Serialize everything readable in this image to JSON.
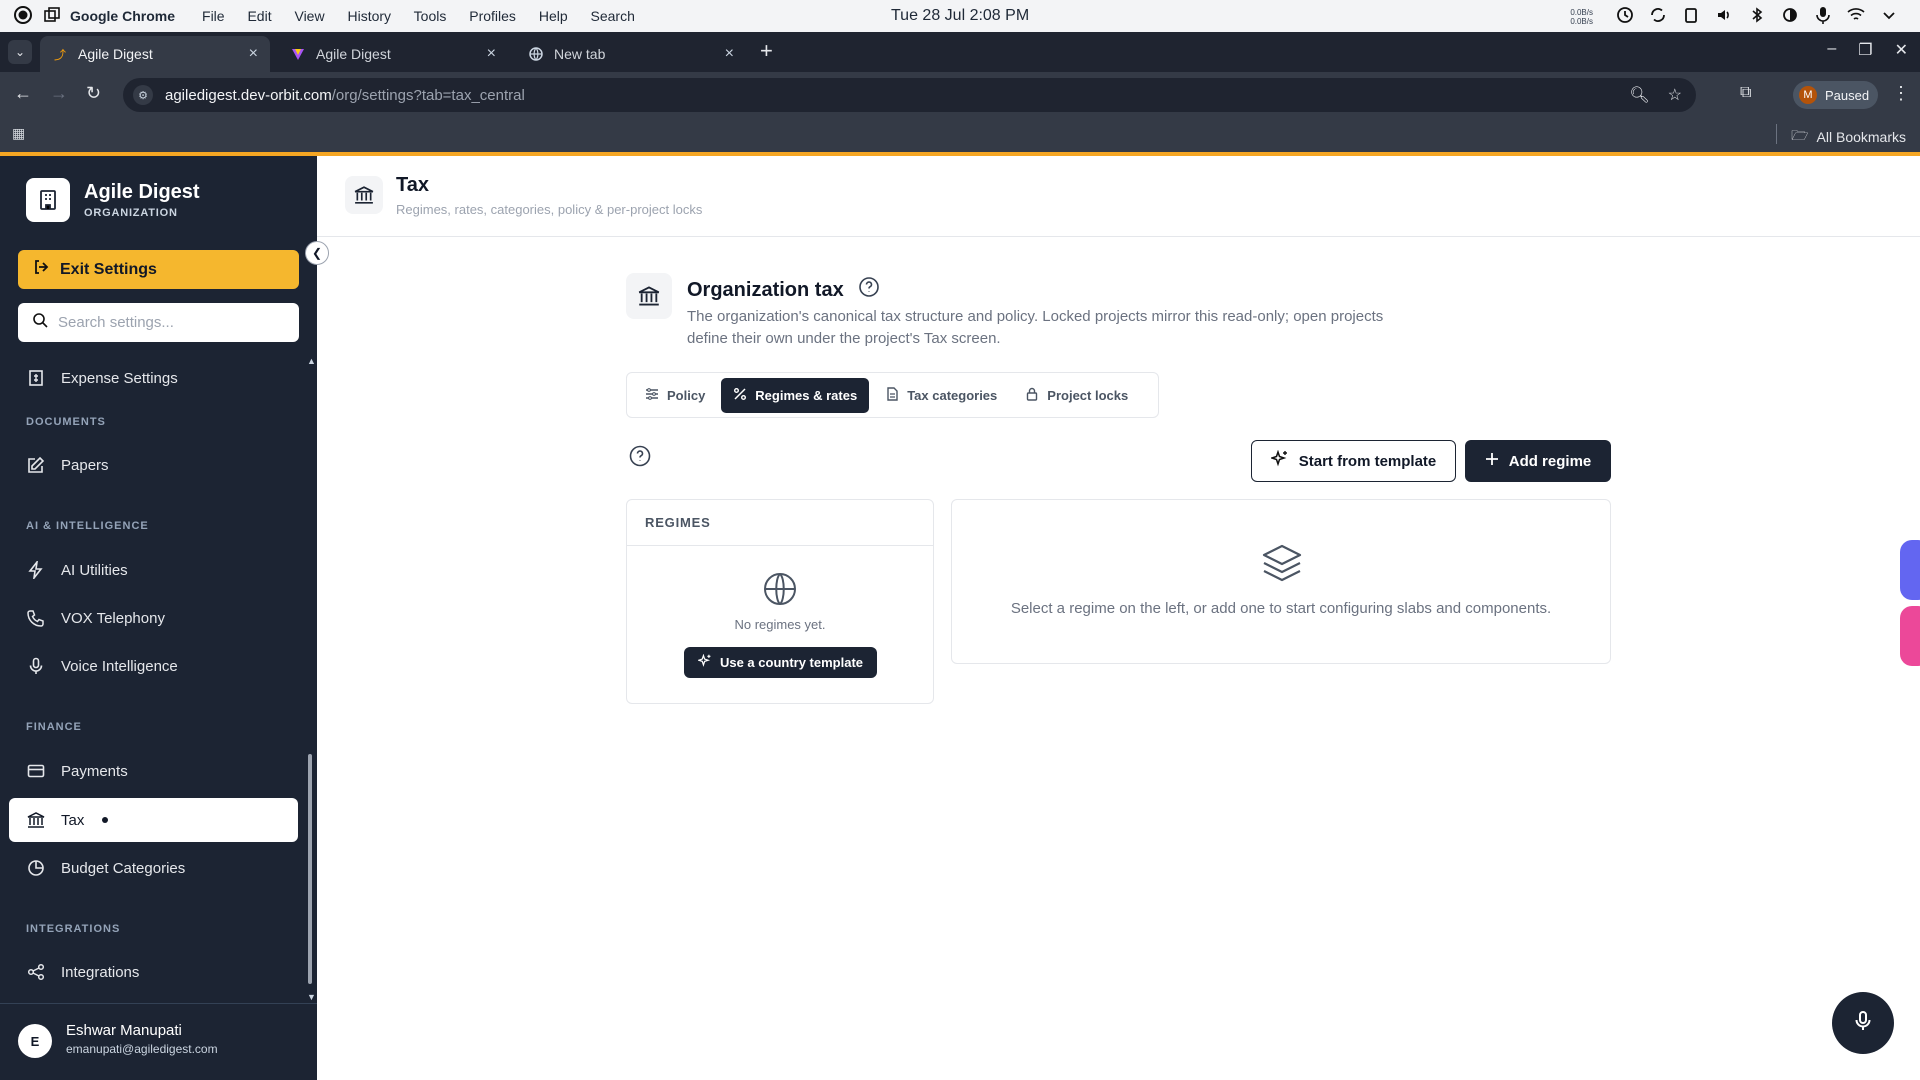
{
  "os": {
    "app_name": "Google Chrome",
    "menu": [
      "File",
      "Edit",
      "View",
      "History",
      "Tools",
      "Profiles",
      "Help",
      "Search"
    ],
    "clock": "Tue 28 Jul  2:08 PM",
    "net_up": "0.0B/s",
    "net_down": "0.0B/s"
  },
  "browser": {
    "tabs": [
      {
        "label": "Agile Digest",
        "active": true
      },
      {
        "label": "Agile Digest",
        "active": false
      },
      {
        "label": "New tab",
        "active": false
      }
    ],
    "url_host": "agiledigest.dev-orbit.com",
    "url_path": "/org/settings?tab=tax_central",
    "profile_initial": "M",
    "profile_status": "Paused",
    "bookmarks_label": "All Bookmarks"
  },
  "sidebar": {
    "brand_name": "Agile Digest",
    "brand_sub": "ORGANIZATION",
    "exit_label": "Exit Settings",
    "search_placeholder": "Search settings...",
    "top_item": "Expense Settings",
    "sections": [
      {
        "title": "DOCUMENTS",
        "items": [
          "Papers"
        ]
      },
      {
        "title": "AI & INTELLIGENCE",
        "items": [
          "AI Utilities",
          "VOX Telephony",
          "Voice Intelligence"
        ]
      },
      {
        "title": "FINANCE",
        "items": [
          "Payments",
          "Tax",
          "Budget Categories"
        ]
      },
      {
        "title": "INTEGRATIONS",
        "items": [
          "Integrations"
        ]
      }
    ],
    "active_item": "Tax",
    "user": {
      "initial": "E",
      "name": "Eshwar Manupati",
      "email": "emanupati@agiledigest.com"
    }
  },
  "header": {
    "title": "Tax",
    "subtitle": "Regimes, rates, categories, policy & per-project locks"
  },
  "org_tax": {
    "title": "Organization tax",
    "description": "The organization's canonical tax structure and policy. Locked projects mirror this read-only; open projects define their own under the project's Tax screen.",
    "tabs": [
      "Policy",
      "Regimes & rates",
      "Tax categories",
      "Project locks"
    ],
    "active_tab": "Regimes & rates",
    "start_template_label": "Start from template",
    "add_regime_label": "Add regime",
    "regimes_header": "REGIMES",
    "empty_text": "No regimes yet.",
    "country_template_label": "Use a country template",
    "detail_message": "Select a regime on the left, or add one to start configuring slabs and components."
  },
  "colors": {
    "sidebar_bg": "#1c2433",
    "accent": "#f5b72e",
    "dark_button": "#1c2433"
  }
}
